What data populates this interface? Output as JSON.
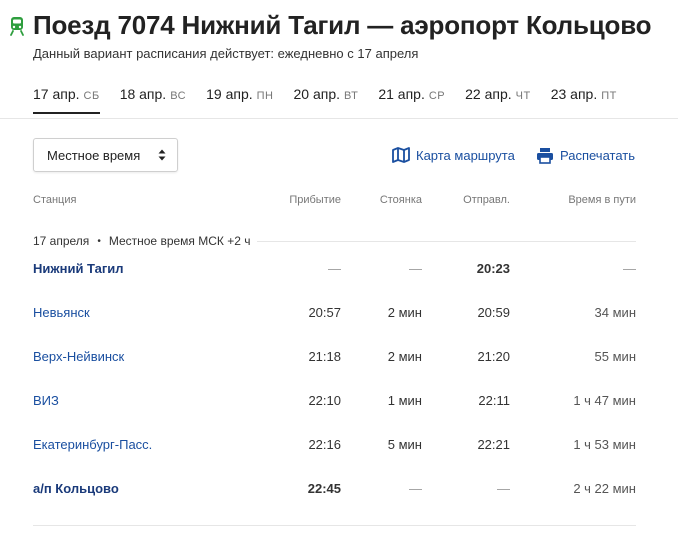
{
  "header": {
    "title": "Поезд 7074 Нижний Тагил — аэропорт Кольцово",
    "subtitle": "Данный вариант расписания действует: ежедневно с 17 апреля",
    "icon": "train-icon",
    "icon_color": "#2e9e3e"
  },
  "tabs": [
    {
      "date": "17 апр.",
      "dow": "СБ",
      "active": true
    },
    {
      "date": "18 апр.",
      "dow": "ВС",
      "active": false
    },
    {
      "date": "19 апр.",
      "dow": "ПН",
      "active": false
    },
    {
      "date": "20 апр.",
      "dow": "ВТ",
      "active": false
    },
    {
      "date": "21 апр.",
      "dow": "СР",
      "active": false
    },
    {
      "date": "22 апр.",
      "dow": "ЧТ",
      "active": false
    },
    {
      "date": "23 апр.",
      "dow": "ПТ",
      "active": false
    }
  ],
  "controls": {
    "time_select": "Местное время",
    "map_link": "Карта маршрута",
    "print_link": "Распечатать",
    "link_color": "#1a4fa0"
  },
  "table": {
    "headers": {
      "station": "Станция",
      "arrival": "Прибытие",
      "stop": "Стоянка",
      "departure": "Отправл.",
      "travel": "Время в пути"
    },
    "group": {
      "date": "17 апреля",
      "tz": "Местное время МСК +2 ч"
    },
    "rows": [
      {
        "station": "Нижний Тагил",
        "arrival": "—",
        "stop": "—",
        "departure": "20:23",
        "travel": "—"
      },
      {
        "station": "Невьянск",
        "arrival": "20:57",
        "stop": "2 мин",
        "departure": "20:59",
        "travel": "34 мин"
      },
      {
        "station": "Верх-Нейвинск",
        "arrival": "21:18",
        "stop": "2 мин",
        "departure": "21:20",
        "travel": "55 мин"
      },
      {
        "station": "ВИЗ",
        "arrival": "22:10",
        "stop": "1 мин",
        "departure": "22:11",
        "travel": "1 ч 47 мин"
      },
      {
        "station": "Екатеринбург-Пасс.",
        "arrival": "22:16",
        "stop": "5 мин",
        "departure": "22:21",
        "travel": "1 ч 53 мин"
      },
      {
        "station": "а/п Кольцово",
        "arrival": "22:45",
        "stop": "—",
        "departure": "—",
        "travel": "2 ч 22 мин"
      }
    ]
  }
}
